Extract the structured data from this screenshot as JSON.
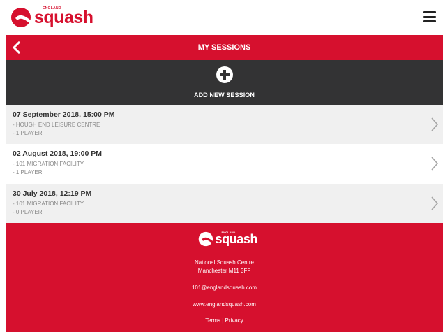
{
  "header": {
    "brand_small": "ENGLAND",
    "brand_word": "squash"
  },
  "titlebar": {
    "title": "MY SESSIONS"
  },
  "add_session": {
    "label": "ADD NEW SESSION"
  },
  "sessions": [
    {
      "date": "07 September 2018, 15:00 PM",
      "venue": "- HOUGH END LEISURE CENTRE",
      "players": "- 1 PLAYER"
    },
    {
      "date": "02 August 2018, 19:00 PM",
      "venue": "- 101 MIGRATION FACILITY",
      "players": "- 1 PLAYER"
    },
    {
      "date": "30 July 2018, 12:19 PM",
      "venue": "- 101 MIGRATION FACILITY",
      "players": "- 0 PLAYER"
    }
  ],
  "footer": {
    "brand_small": "ENGLAND",
    "brand_word": "squash",
    "address_line1": "National Squash Centre",
    "address_line2": "Manchester M11 3FF",
    "email": "101@englandsquash.com",
    "website": "www.englandsquash.com",
    "terms": "Terms",
    "separator": "|",
    "privacy": "Privacy"
  },
  "colors": {
    "brand_red": "#d6102e",
    "dark_bar": "#333334",
    "row_alt": "#f0f0f0"
  },
  "icons": {
    "menu": "hamburger-menu-icon",
    "back": "chevron-left-icon",
    "add": "plus-circle-icon",
    "row": "chevron-right-icon"
  }
}
